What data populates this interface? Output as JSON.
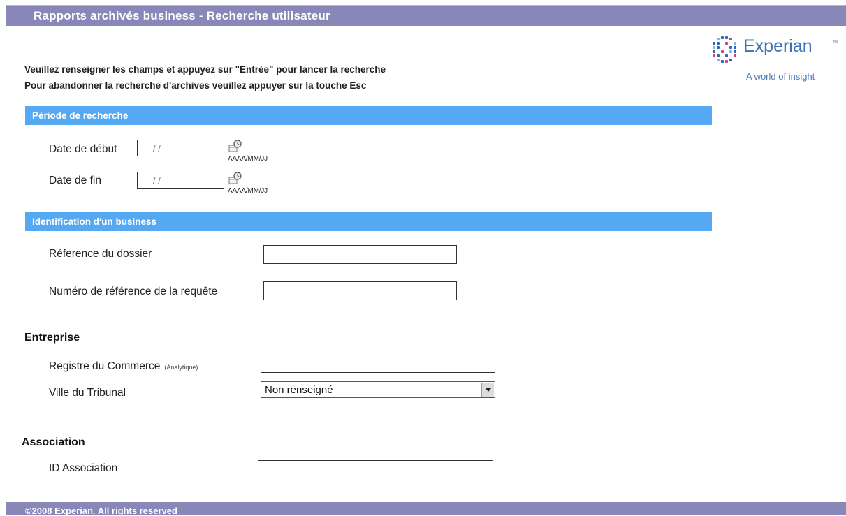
{
  "window": {
    "title": "Rapports archivés business - Recherche utilisateur"
  },
  "logo": {
    "name": "Experian",
    "trademark": "™",
    "tagline": "A world of insight"
  },
  "intro": {
    "line1": "Veuillez renseigner les champs et appuyez sur \"Entrée\" pour lancer la recherche",
    "line2": "Pour abandonner la recherche d'archives veuillez appuyer sur la touche Esc"
  },
  "period": {
    "header": "Période de recherche",
    "start": {
      "label": "Date de début",
      "value": "/ /",
      "format": "AAAA/MM/JJ",
      "icon": "calendar-picker-icon"
    },
    "end": {
      "label": "Date de fin",
      "value": "/ /",
      "format": "AAAA/MM/JJ",
      "icon": "calendar-picker-icon"
    }
  },
  "identification": {
    "header": "Identification d'un business",
    "file_ref": {
      "label": "Réference du dossier",
      "value": ""
    },
    "request_ref": {
      "label": "Numéro de référence de la requête",
      "value": ""
    }
  },
  "company": {
    "title": "Entreprise",
    "registry": {
      "label": "Registre du Commerce",
      "note": "(Analytique)",
      "value": ""
    },
    "court_city": {
      "label": "Ville du Tribunal",
      "selected": "Non renseigné"
    }
  },
  "association": {
    "title": "Association",
    "id": {
      "label": "ID Association",
      "value": ""
    }
  },
  "footer": {
    "copyright": "©2008 Experian. All rights reserved"
  },
  "colors": {
    "titlebar": "#8986b8",
    "section_bar": "#55a9f2",
    "brand_blue": "#3a72b5"
  }
}
